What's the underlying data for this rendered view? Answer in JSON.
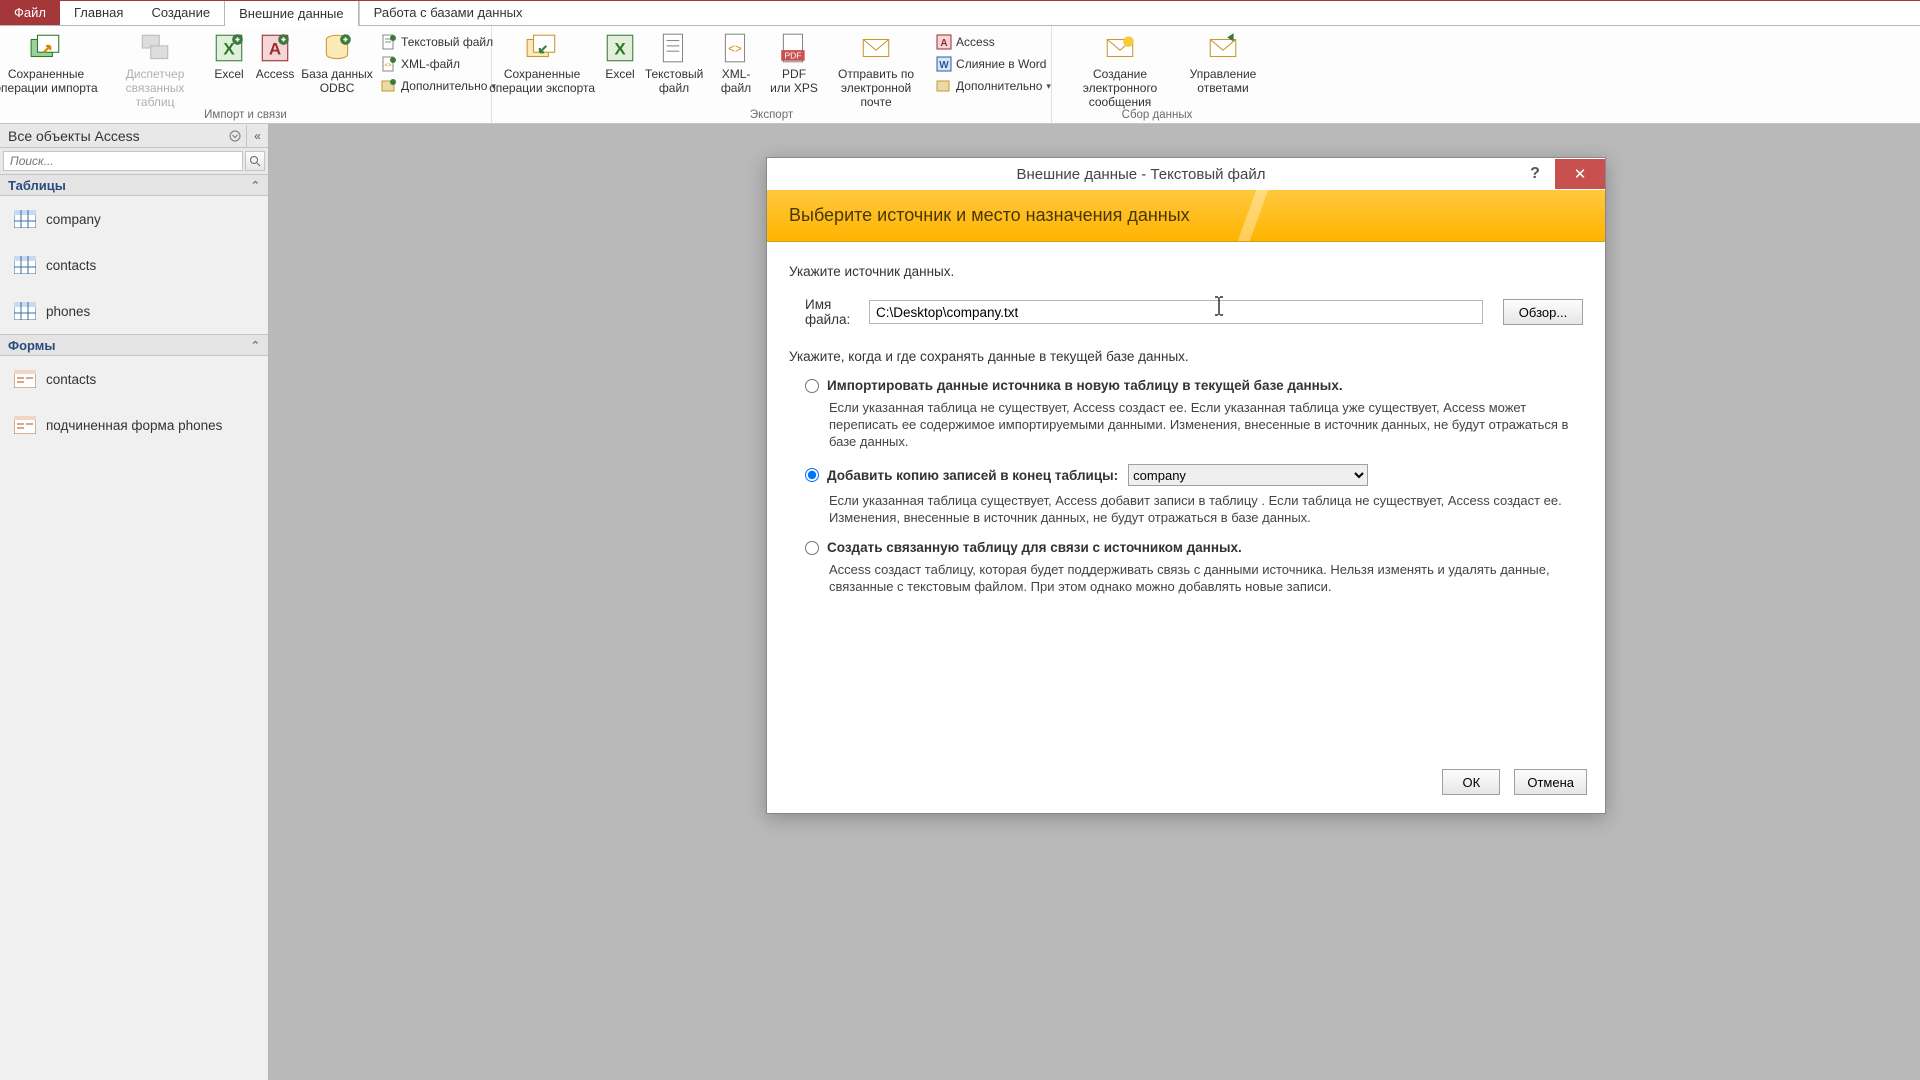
{
  "tabs": {
    "file": "Файл",
    "home": "Главная",
    "create": "Создание",
    "external": "Внешние данные",
    "db": "Работа с базами данных"
  },
  "ribbon": {
    "group_import_label": "Импорт и связи",
    "group_export_label": "Экспорт",
    "group_collect_label": "Сбор данных",
    "saved_imports": "Сохраненные\nоперации импорта",
    "linked_manager": "Диспетчер\nсвязанных таблиц",
    "excel": "Excel",
    "access": "Access",
    "odbc": "База данных\nODBC",
    "text_file": "Текстовый файл",
    "xml_file": "XML-файл",
    "more": "Дополнительно",
    "saved_exports": "Сохраненные\nоперации экспорта",
    "excel2": "Excel",
    "text_file2": "Текстовый\nфайл",
    "xml2": "XML-файл",
    "pdf": "PDF\nили XPS",
    "email": "Отправить по\nэлектронной почте",
    "access2": "Access",
    "word_merge": "Слияние в Word",
    "more2": "Дополнительно",
    "create_email": "Создание электронного\nсообщения",
    "manage_replies": "Управление\nответами"
  },
  "nav": {
    "header": "Все объекты Access",
    "search_placeholder": "Поиск...",
    "sec_tables": "Таблицы",
    "sec_forms": "Формы",
    "tables": [
      "company",
      "contacts",
      "phones"
    ],
    "forms": [
      "contacts",
      "подчиненная форма phones"
    ]
  },
  "dialog": {
    "title": "Внешние данные - Текстовый файл",
    "banner": "Выберите источник и место назначения данных",
    "source_hint": "Укажите источник данных.",
    "file_label": "Имя файла:",
    "file_value": "C:\\Desktop\\company.txt",
    "browse": "Обзор...",
    "store_hint": "Укажите, когда и где сохранять данные в текущей базе данных.",
    "opt1_label": "Импортировать данные источника в новую таблицу в текущей базе данных.",
    "opt1_desc": "Если указанная таблица не существует, Access создаст ее. Если указанная таблица уже существует, Access может переписать ее содержимое импортируемыми данными. Изменения, внесенные в источник данных, не будут отражаться в базе данных.",
    "opt2_label": "Добавить копию записей в конец таблицы:",
    "opt2_select": "company",
    "opt2_desc": "Если указанная таблица существует, Access добавит записи в таблицу . Если таблица не существует, Access создаст ее. Изменения, внесенные в источник данных, не будут отражаться в базе данных.",
    "opt3_label": "Создать связанную таблицу для связи с источником данных.",
    "opt3_desc": "Access создаст таблицу, которая будет поддерживать связь с данными источника. Нельзя изменять и удалять данные, связанные с текстовым файлом. При этом однако можно добавлять новые записи.",
    "ok": "ОК",
    "cancel": "Отмена"
  }
}
